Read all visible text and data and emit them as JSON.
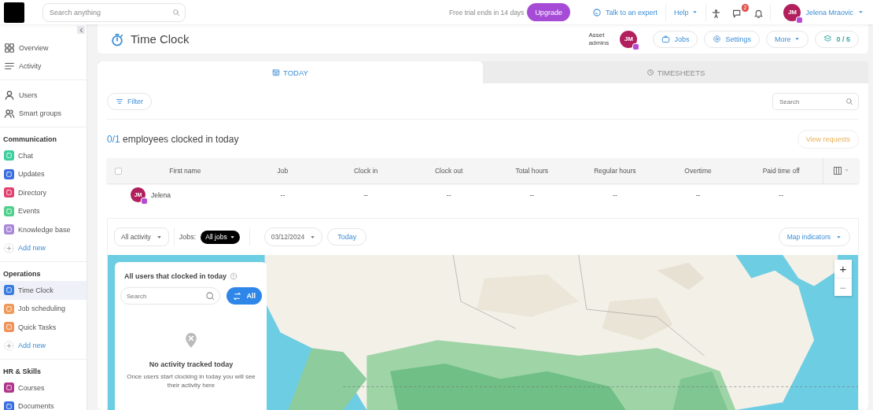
{
  "topbar": {
    "search": {
      "placeholder": "Search anything"
    },
    "trial": "Free trial ends in 14 days",
    "upgrade": "Upgrade",
    "expert": "Talk to an expert",
    "help": "Help",
    "chat_badge": "2",
    "user": {
      "initials": "JM",
      "name": "Jelena Mraovic"
    }
  },
  "sidebar": {
    "sections": [
      {
        "items": [
          {
            "label": "Overview",
            "kind": "line",
            "selected": false
          },
          {
            "label": "Activity",
            "kind": "line",
            "selected": false
          }
        ]
      },
      {
        "items": [
          {
            "label": "Users",
            "kind": "line",
            "selected": false
          },
          {
            "label": "Smart groups",
            "kind": "line",
            "selected": false
          }
        ]
      },
      {
        "title": "Communication",
        "items": [
          {
            "label": "Chat",
            "kind": "app",
            "color": "#3ccf9e",
            "selected": false
          },
          {
            "label": "Updates",
            "kind": "app",
            "color": "#3b6fe0",
            "selected": false
          },
          {
            "label": "Directory",
            "kind": "app",
            "color": "#e0426f",
            "selected": false
          },
          {
            "label": "Events",
            "kind": "app",
            "color": "#4fd08a",
            "selected": false
          },
          {
            "label": "Knowledge base",
            "kind": "app",
            "color": "#a98ad8",
            "selected": false
          },
          {
            "label": "Add new",
            "kind": "add",
            "selected": false
          }
        ]
      },
      {
        "title": "Operations",
        "items": [
          {
            "label": "Time Clock",
            "kind": "app",
            "color": "#3a7de0",
            "selected": true
          },
          {
            "label": "Job scheduling",
            "kind": "app",
            "color": "#f09a5a",
            "selected": false
          },
          {
            "label": "Quick Tasks",
            "kind": "app",
            "color": "#f0935a",
            "selected": false
          },
          {
            "label": "Add new",
            "kind": "add",
            "selected": false
          }
        ]
      },
      {
        "title": "HR & Skills",
        "items": [
          {
            "label": "Courses",
            "kind": "app",
            "color": "#b0358a",
            "selected": false
          },
          {
            "label": "Documents",
            "kind": "app",
            "color": "#3b6fe0",
            "selected": false
          }
        ]
      }
    ]
  },
  "header": {
    "title": "Time Clock",
    "admins_label": "Asset admins",
    "admin_initials": "JM",
    "buttons": [
      {
        "label": "Jobs",
        "kind": "jobs"
      },
      {
        "label": "Settings",
        "kind": "settings"
      },
      {
        "label": "More",
        "kind": "more"
      },
      {
        "label": "0 / 5",
        "kind": "count"
      }
    ]
  },
  "tabs": [
    {
      "label": "TODAY",
      "selected": true
    },
    {
      "label": "TIMESHEETS",
      "selected": false
    }
  ],
  "filter": "Filter",
  "search": {
    "placeholder": "Search"
  },
  "summary": {
    "count": "0/1",
    "text": "employees clocked in today"
  },
  "view_requests": "View requests",
  "table": {
    "select_all_checked": false,
    "columns": [
      "First name",
      "Job",
      "Clock in",
      "Clock out",
      "Total hours",
      "Regular hours",
      "Overtime",
      "Paid time off"
    ],
    "rows": [
      {
        "checked": false,
        "initials": "JM",
        "cells": [
          "Jelena",
          "--",
          "--",
          "--",
          "--",
          "--",
          "--",
          "--"
        ]
      }
    ]
  },
  "map_toolbar": {
    "activity": "All activity",
    "jobs_label": "Jobs:",
    "jobs": "All jobs",
    "date": "03/12/2024",
    "today": "Today",
    "indicators": "Map indicators"
  },
  "map": {
    "kind": "picture",
    "zoom_in": "+",
    "zoom_out": "−"
  },
  "users_panel": {
    "title": "All users that clocked in today",
    "search_placeholder": "Search",
    "all": "All",
    "empty_title": "No activity tracked today",
    "empty_text": "Once users start clocking in today you will see their activity here"
  }
}
